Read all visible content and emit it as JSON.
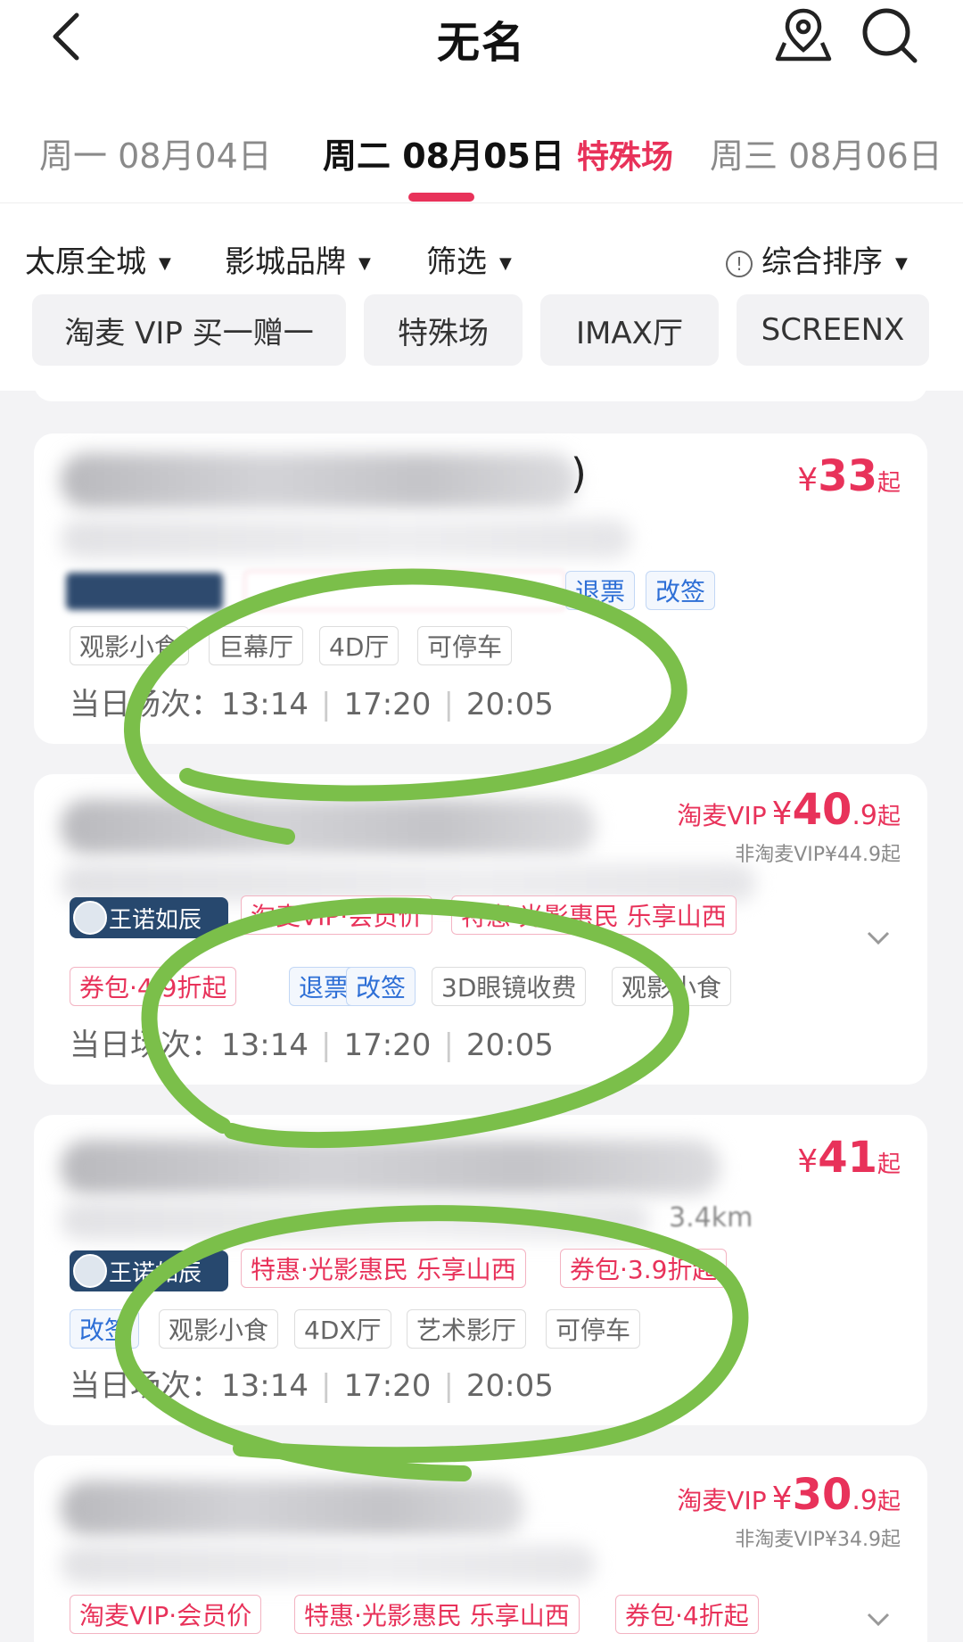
{
  "header": {
    "title": "无名",
    "back_icon": "chevron-left-icon",
    "map_icon": "map-pin-icon",
    "search_icon": "search-icon"
  },
  "date_tabs": [
    {
      "label": "周一 08月04日"
    },
    {
      "label": "周二 08月05日",
      "special": "特殊场"
    },
    {
      "label": "周三 08月06日"
    }
  ],
  "filters": {
    "city": "太原全城",
    "brand": "影城品牌",
    "filter": "筛选",
    "sort": "综合排序"
  },
  "chips": [
    "淘麦 VIP 买一赠一",
    "特殊场",
    "IMAX厅",
    "SCREENX"
  ],
  "colors": {
    "accent": "#e8325a",
    "tag_blue": "#2e6fd6",
    "annotation_green": "#7bbf4a"
  },
  "cards": [
    {
      "name_tail": ")",
      "price": {
        "yen": "¥",
        "int": "33",
        "suffix": "起"
      },
      "badge_tags": [
        "退票",
        "改签"
      ],
      "feature_tags": [
        "观影小食",
        "巨幕厅",
        "4D厅",
        "可停车"
      ],
      "showtimes_label": "当日场次：",
      "showtimes": [
        "13:14",
        "17:20",
        "20:05"
      ]
    },
    {
      "price": {
        "vip": "淘麦VIP",
        "yen": "¥",
        "int": "40",
        "dec": ".9",
        "suffix": "起"
      },
      "subprice": "非淘麦VIP¥44.9起",
      "badge": "王诺如辰",
      "promo_tags": [
        "淘麦VIP·会员价",
        "特惠·光影惠民 乐享山西"
      ],
      "feature_tags": [
        "券包·4.9折起",
        "退票",
        "改签",
        "3D眼镜收费",
        "观影小食"
      ],
      "showtimes_label": "当日场次：",
      "showtimes": [
        "13:14",
        "17:20",
        "20:05"
      ]
    },
    {
      "distance": "3.4km",
      "price": {
        "yen": "¥",
        "int": "41",
        "suffix": "起"
      },
      "badge": "王诺如辰",
      "promo_tags": [
        "特惠·光影惠民 乐享山西",
        "券包·3.9折起"
      ],
      "feature_tags": [
        "改签",
        "观影小食",
        "4DX厅",
        "艺术影厅",
        "可停车"
      ],
      "showtimes_label": "当日场次：",
      "showtimes": [
        "13:14",
        "17:20",
        "20:05"
      ]
    },
    {
      "price": {
        "vip": "淘麦VIP",
        "yen": "¥",
        "int": "30",
        "dec": ".9",
        "suffix": "起"
      },
      "subprice": "非淘麦VIP¥34.9起",
      "promo_tags": [
        "淘麦VIP·会员价",
        "特惠·光影惠民 乐享山西",
        "券包·4折起"
      ]
    }
  ]
}
